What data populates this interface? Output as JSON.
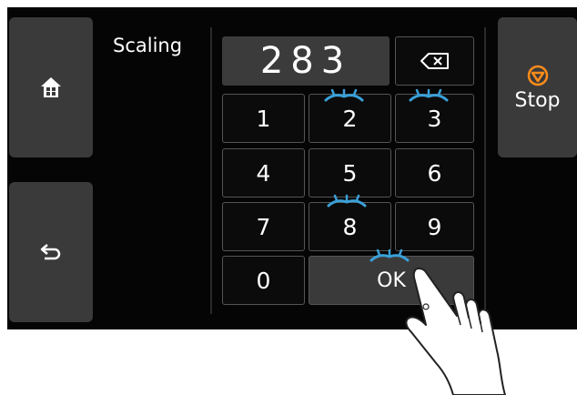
{
  "screen": {
    "title": "Scaling",
    "display_value": "283"
  },
  "stop": {
    "label": "Stop",
    "icon": "stop-icon"
  },
  "home": {
    "icon": "home-icon"
  },
  "back": {
    "icon": "back-arrow-icon"
  },
  "keypad": {
    "k1": "1",
    "k2": "2",
    "k3": "3",
    "k4": "4",
    "k5": "5",
    "k6": "6",
    "k7": "7",
    "k8": "8",
    "k9": "9",
    "k0": "0",
    "ok": "OK",
    "backspace_icon": "backspace-icon"
  },
  "colors": {
    "panel_bg": "#050505",
    "button_bg": "#3a3a3a",
    "stop_accent": "#ff8c1a",
    "sparkle": "#3aa0d8"
  }
}
